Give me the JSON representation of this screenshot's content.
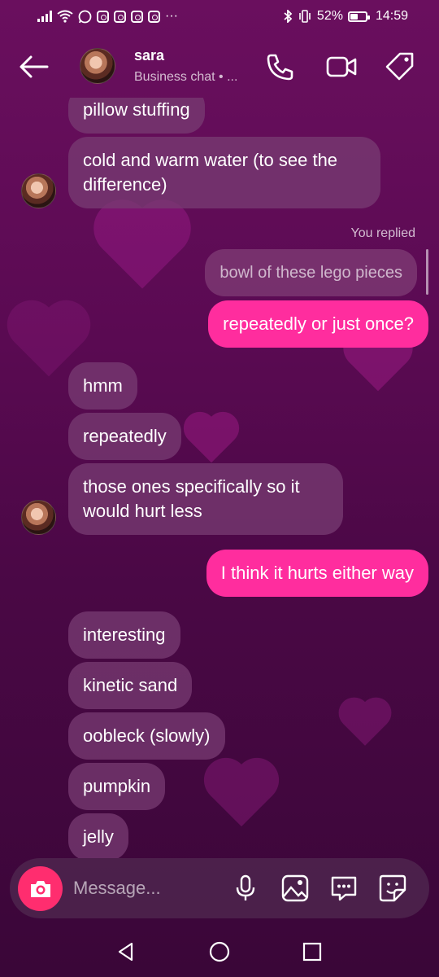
{
  "status_bar": {
    "dots": "···",
    "battery_percent": "52%",
    "battery_level": 0.52,
    "time": "14:59"
  },
  "header": {
    "contact_name": "sara",
    "subtitle": "Business chat • ..."
  },
  "messages": [
    {
      "direction": "in",
      "text": "pillow stuffing"
    },
    {
      "direction": "in",
      "text": "cold and warm water (to see the difference)"
    },
    {
      "direction": "out",
      "replied_label": "You replied",
      "quoted_text": "bowl of these lego pieces",
      "text": "repeatedly or just once?"
    },
    {
      "direction": "in",
      "text": "hmm"
    },
    {
      "direction": "in",
      "text": "repeatedly"
    },
    {
      "direction": "in",
      "text": "those ones specifically so it would hurt less"
    },
    {
      "direction": "out",
      "text": "I think it hurts either way"
    },
    {
      "direction": "in",
      "text": "interesting"
    },
    {
      "direction": "in",
      "text": "kinetic sand"
    },
    {
      "direction": "in",
      "text": "oobleck (slowly)"
    },
    {
      "direction": "in",
      "text": "pumpkin"
    },
    {
      "direction": "in",
      "text": "jelly"
    }
  ],
  "composer": {
    "placeholder": "Message...",
    "icons": [
      "camera-icon",
      "microphone-icon",
      "gallery-icon",
      "chat-bubble-icon",
      "sticker-icon"
    ]
  },
  "colors": {
    "outgoing_bubble": "#ff2d9e",
    "incoming_bubble": "#783c73",
    "camera_button": "#ff2d6f",
    "background": "#5a0a52"
  }
}
